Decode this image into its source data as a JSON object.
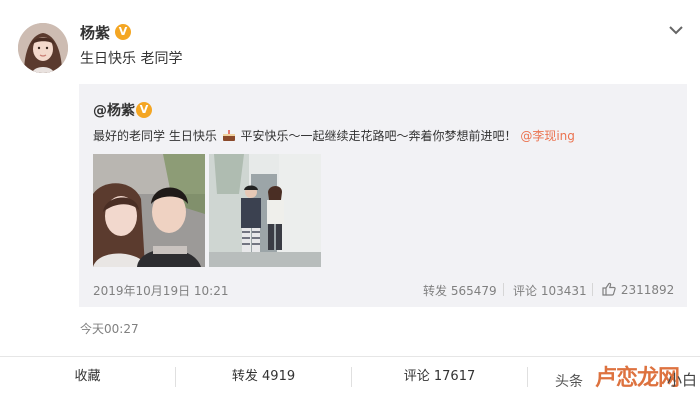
{
  "post": {
    "author": "杨紫",
    "verified_badge": "V",
    "text": "生日快乐 老同学",
    "time": "今天00:27"
  },
  "repost": {
    "author": "@杨紫",
    "verified_badge": "V",
    "text_before": "最好的老同学 生日快乐",
    "text_after": "平安快乐～一起继续走花路吧～奔着你梦想前进吧！",
    "mention": "@李现ing",
    "time": "2019年10月19日 10:21",
    "repost_stat": "转发 565479",
    "comment_stat": "评论 103431",
    "like_stat": "2311892"
  },
  "actions": {
    "favorite": "收藏",
    "repost": "转发 4919",
    "comment": "评论 17617"
  },
  "watermark": {
    "prefix": "头条",
    "logo": "卢恋龙网",
    "suffix": "小白"
  },
  "colors": {
    "mention": "#eb7350",
    "badge": "#f4a623",
    "repost_bg": "#f2f2f5"
  },
  "icons": [
    "avatar",
    "verified-badge-icon",
    "chevron-down-icon",
    "cake-emoji-icon",
    "thumbs-up-icon"
  ]
}
